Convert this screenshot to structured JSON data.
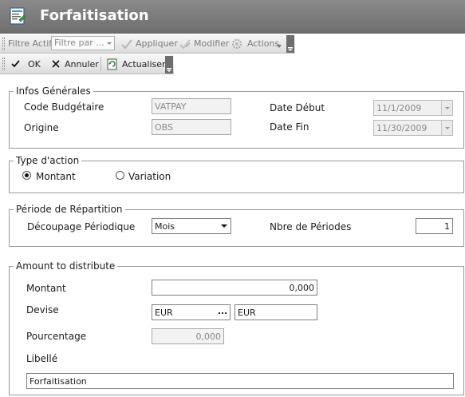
{
  "window": {
    "title": "Forfaitisation"
  },
  "toolbar1": {
    "filter_label": "Filtre Actif",
    "filter_placeholder": "Filtre par ...",
    "apply_label": "Appliquer",
    "modify_label": "Modifier",
    "actions_label": "Actions"
  },
  "toolbar2": {
    "ok_label": "OK",
    "cancel_label": "Annuler",
    "refresh_label": "Actualiser"
  },
  "general": {
    "title": "Infos Générales",
    "budget_code_label": "Code Budgétaire",
    "budget_code_value": "VATPAY",
    "origin_label": "Origine",
    "origin_value": "OBS",
    "start_date_label": "Date Début",
    "start_date_value": "11/1/2009",
    "end_date_label": "Date Fin",
    "end_date_value": "11/30/2009"
  },
  "action_type": {
    "title": "Type d'action",
    "option_amount": "Montant",
    "option_variation": "Variation",
    "selected": "Montant"
  },
  "period": {
    "title": "Période de Répartition",
    "split_label": "Découpage Périodique",
    "split_value": "Mois",
    "count_label": "Nbre de Périodes",
    "count_value": "1"
  },
  "distribution": {
    "title": "Amount to distribute",
    "amount_label": "Montant",
    "amount_value": "0,000",
    "currency_label": "Devise",
    "currency_code": "EUR",
    "currency_name": "EUR",
    "percent_label": "Pourcentage",
    "percent_value": "0,000",
    "caption_label": "Libellé",
    "caption_value": "Forfaitisation"
  },
  "colors": {
    "titlebar": "#7c7c7c",
    "toolbar": "#e4e4e4",
    "group_border": "#9a9a9a"
  }
}
